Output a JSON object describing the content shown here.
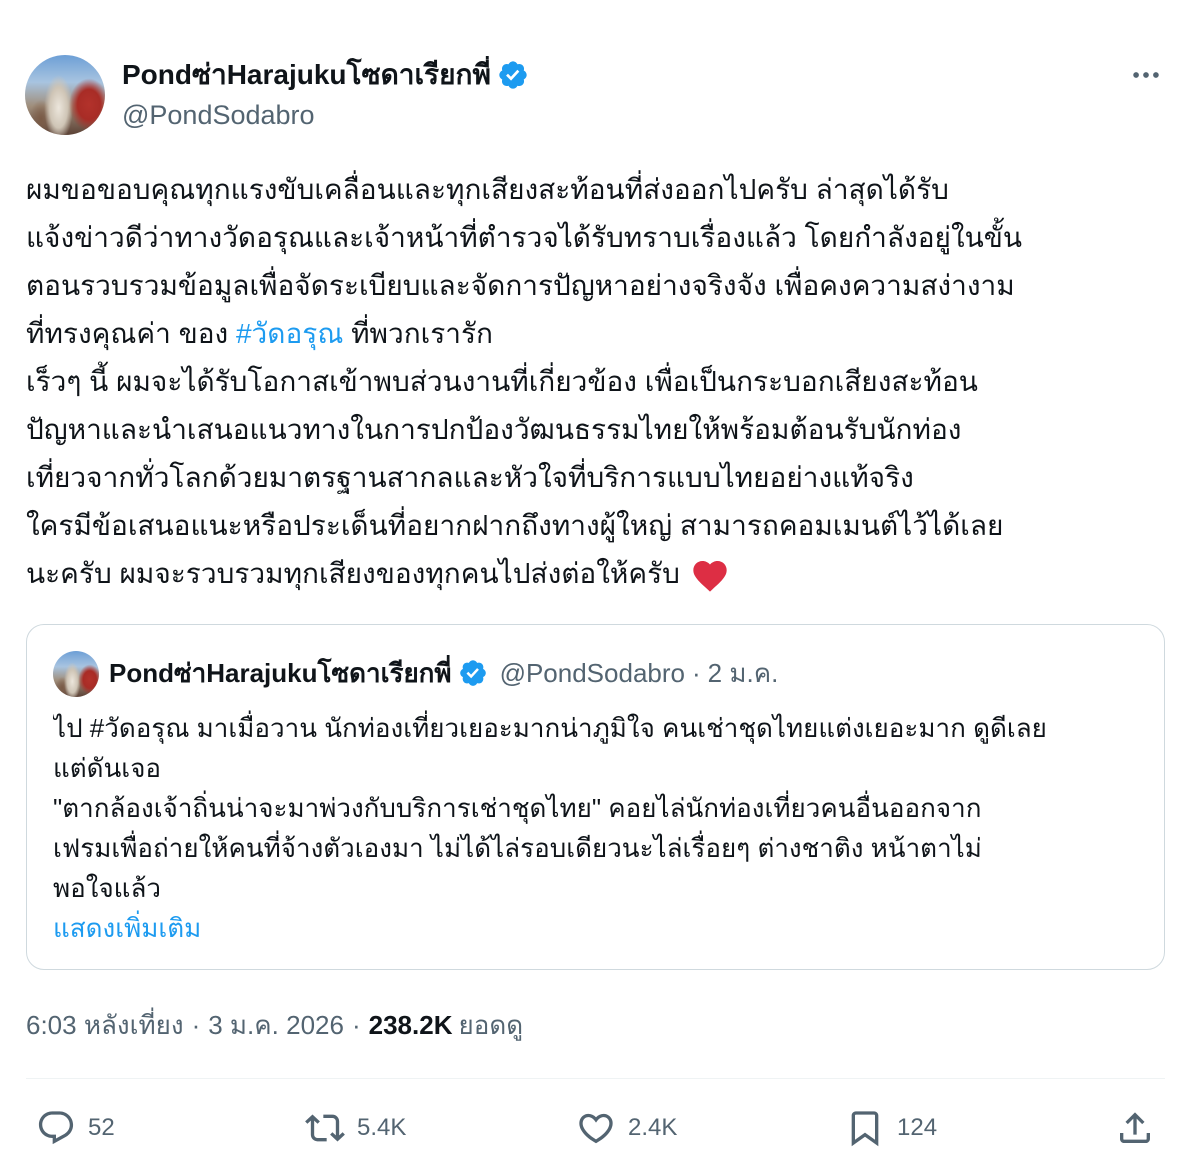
{
  "colors": {
    "text": "#0f1419",
    "secondary": "#536471",
    "link": "#1d9bf0",
    "verified": "#1d9bf0",
    "border": "#cfd9de",
    "divider": "#eff3f4",
    "emoji_heart": "#dd2e44",
    "background": "#ffffff"
  },
  "author": {
    "display_name": "Pondซ่าHarajukuโซดาเรียกพี่",
    "handle": "@PondSodabro",
    "avatar_icon": "avatar-photo",
    "verified_icon": "verified-badge-icon"
  },
  "tweet": {
    "more_icon": "more-options-icon",
    "body_lines": [
      "ผมขอขอบคุณทุกแรงขับเคลื่อนและทุกเสียงสะท้อนที่ส่งออกไปครับ ล่าสุดได้รับ",
      "แจ้งข่าวดีว่าทางวัดอรุณและเจ้าหน้าที่ตำรวจได้รับทราบเรื่องแล้ว โดยกำลังอยู่ในขั้น",
      "ตอนรวบรวมข้อมูลเพื่อจัดระเบียบและจัดการปัญหาอย่างจริงจัง เพื่อคงความสง่างาม",
      {
        "before": "ที่ทรงคุณค่า ของ ",
        "hashtag": "#วัดอรุณ",
        "after": " ที่พวกเรารัก"
      },
      "เร็วๆ นี้ ผมจะได้รับโอกาสเข้าพบส่วนงานที่เกี่ยวข้อง เพื่อเป็นกระบอกเสียงสะท้อน",
      "ปัญหาและนำเสนอแนวทางในการปกป้องวัฒนธรรมไทยให้พร้อมต้อนรับนักท่อง",
      "เที่ยวจากทั่วโลกด้วยมาตรฐานสากลและหัวใจที่บริการแบบไทยอย่างแท้จริง",
      "ใครมีข้อเสนอแนะหรือประเด็นที่อยากฝากถึงทางผู้ใหญ่ สามารถคอมเมนต์ไว้ได้เลย",
      {
        "text": "นะครับ ผมจะรวบรวมทุกเสียงของทุกคนไปส่งต่อให้ครับ",
        "emoji_icon": "red-heart-emoji-icon"
      }
    ]
  },
  "quoted_tweet": {
    "author": {
      "display_name": "Pondซ่าHarajukuโซดาเรียกพี่",
      "handle": "@PondSodabro",
      "avatar_icon": "avatar-photo",
      "verified_icon": "verified-badge-icon"
    },
    "separator": "·",
    "date": "2 ม.ค.",
    "body_lines": [
      "ไป #วัดอรุณ มาเมื่อวาน นักท่องเที่ยวเยอะมากน่าภูมิใจ คนเช่าชุดไทยแต่งเยอะมาก ดูดีเลย",
      "แต่ดันเจอ",
      "\"ตากล้องเจ้าถิ่นน่าจะมาพ่วงกับบริการเช่าชุดไทย\" คอยไล่นักท่องเที่ยวคนอื่นออกจาก",
      "เฟรมเพื่อถ่ายให้คนที่จ้างตัวเองมา ไม่ได้ไล่รอบเดียวนะไล่เรื่อยๆ ต่างชาติง หน้าตาไม่",
      "พอใจแล้ว"
    ],
    "show_more_label": "แสดงเพิ่มเติม"
  },
  "meta": {
    "time": "6:03 หลังเที่ยง",
    "separator": "·",
    "date": "3 ม.ค. 2026",
    "views_count": "238.2K",
    "views_label": "ยอดดู"
  },
  "actions": {
    "reply": {
      "icon": "reply-icon",
      "count": "52"
    },
    "retweet": {
      "icon": "retweet-icon",
      "count": "5.4K"
    },
    "like": {
      "icon": "heart-icon",
      "count": "2.4K"
    },
    "bookmark": {
      "icon": "bookmark-icon",
      "count": "124"
    },
    "share": {
      "icon": "share-icon"
    }
  }
}
